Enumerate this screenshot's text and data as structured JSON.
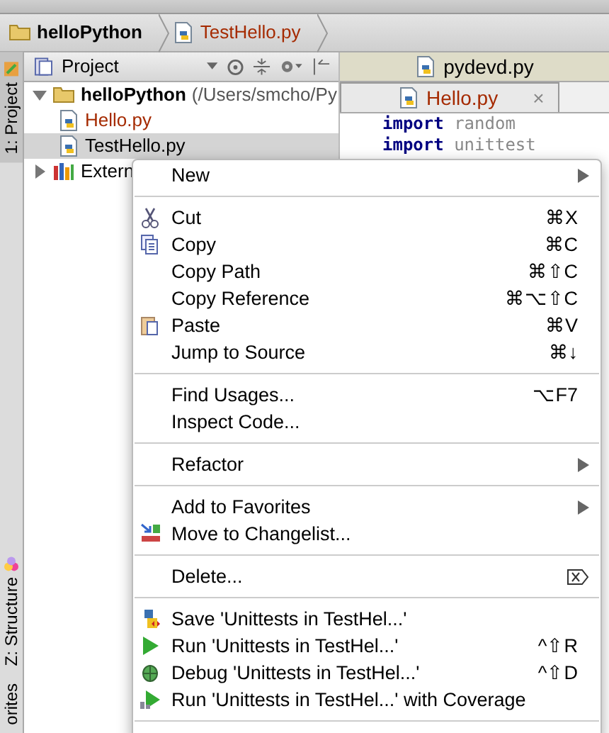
{
  "breadcrumb": [
    {
      "label": "helloPython",
      "kind": "folder"
    },
    {
      "label": "TestHello.py",
      "kind": "file"
    }
  ],
  "side_tabs": [
    {
      "label": "1: Project",
      "selected": true
    },
    {
      "label": "Z: Structure",
      "selected": false
    },
    {
      "label": "orites",
      "selected": false
    }
  ],
  "project_panel": {
    "title": "Project",
    "tree": [
      {
        "label": "helloPython",
        "path": "(/Users/smcho/Py",
        "kind": "folder",
        "expanded": true,
        "selected": false,
        "children": [
          {
            "label": "Hello.py",
            "kind": "file",
            "selected": false
          },
          {
            "label": "TestHello.py",
            "kind": "file",
            "selected": true
          }
        ]
      },
      {
        "label": "Extern",
        "kind": "library",
        "expanded": false,
        "selected": false
      }
    ]
  },
  "editor": {
    "tabs": [
      {
        "label": "pydevd.py",
        "selected": false
      },
      {
        "label": "Hello.py",
        "selected": true,
        "close": "×"
      }
    ],
    "code_lines": [
      "**import** random",
      "**import** unittest"
    ]
  },
  "context_menu": [
    {
      "kind": "item",
      "label": "New",
      "submenu": true
    },
    {
      "kind": "separator"
    },
    {
      "kind": "item",
      "label": "Cut",
      "shortcut": "⌘X"
    },
    {
      "kind": "item",
      "label": "Copy",
      "shortcut": "⌘C"
    },
    {
      "kind": "item",
      "label": "Copy Path",
      "shortcut": "⌘⇧C"
    },
    {
      "kind": "item",
      "label": "Copy Reference",
      "shortcut": "⌘⌥⇧C"
    },
    {
      "kind": "item",
      "label": "Paste",
      "shortcut": "⌘V"
    },
    {
      "kind": "item",
      "label": "Jump to Source",
      "shortcut": "⌘↓"
    },
    {
      "kind": "separator"
    },
    {
      "kind": "item",
      "label": "Find Usages...",
      "shortcut": "⌥F7"
    },
    {
      "kind": "item",
      "label": "Inspect Code..."
    },
    {
      "kind": "separator"
    },
    {
      "kind": "item",
      "label": "Refactor",
      "submenu": true
    },
    {
      "kind": "separator"
    },
    {
      "kind": "item",
      "label": "Add to Favorites",
      "submenu": true
    },
    {
      "kind": "item",
      "label": "Move to Changelist..."
    },
    {
      "kind": "separator"
    },
    {
      "kind": "item",
      "label": "Delete..."
    },
    {
      "kind": "separator"
    },
    {
      "kind": "item",
      "label": "Save 'Unittests in TestHel...'"
    },
    {
      "kind": "item",
      "label": "Run 'Unittests in TestHel...'",
      "shortcut": "^⇧R"
    },
    {
      "kind": "item",
      "label": "Debug 'Unittests in TestHel...'",
      "shortcut": "^⇧D"
    },
    {
      "kind": "item",
      "label": "Run 'Unittests in TestHel...' with Coverage"
    },
    {
      "kind": "separator"
    }
  ]
}
